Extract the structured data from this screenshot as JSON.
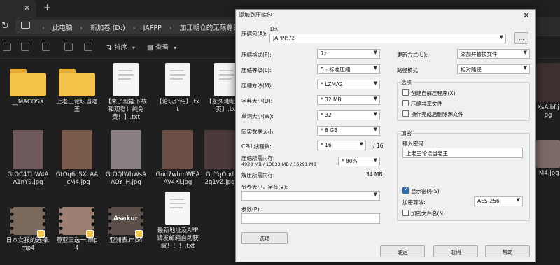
{
  "explorer": {
    "breadcrumb": [
      "此电脑",
      "新加卷 (D:)",
      "JAPPP",
      "加江朝仓的无限尊日"
    ],
    "toolbar": {
      "sort_label": "排序",
      "view_label": "查看"
    },
    "files": [
      {
        "name": "__MACOSX",
        "type": "folder"
      },
      {
        "name": "上老王论坛当老王",
        "type": "folder"
      },
      {
        "name": "【来了就能下载和观看！纯免费！】.txt",
        "type": "doc"
      },
      {
        "name": "【论坛介绍】.txt",
        "type": "doc"
      },
      {
        "name": "【永久地址发布页】.txt",
        "type": "doc"
      },
      {
        "name": "GtOC4TUW4AA1nY9.jpg",
        "type": "photo",
        "color": "#6e5a5a"
      },
      {
        "name": "GtOq6oSXcAA_cM4.jpg",
        "type": "photo",
        "color": "#7a5c4c"
      },
      {
        "name": "GtOQlWhWsAAOY_H.jpg",
        "type": "photo",
        "color": "#8a7f80"
      },
      {
        "name": "Gud7wbmWEAAV4Xi.jpg",
        "type": "photo",
        "color": "#6b4f45"
      },
      {
        "name": "GuYqOud2q1vZ.jpg",
        "type": "photo",
        "color": "#4a3a3a"
      },
      {
        "name": "日本女孩的选择.mp4",
        "type": "video",
        "color": "#7a6a5e"
      },
      {
        "name": "尊亚三选一.mp4",
        "type": "video",
        "color": "#9b8072"
      },
      {
        "name": "亚洲表.mp4",
        "type": "video",
        "color": "#5a4f49",
        "overlay": "Asakur"
      },
      {
        "name": "最新地址及APP请发邮箱自动获取！！！.txt",
        "type": "doc"
      }
    ],
    "right_partial": [
      {
        "name": "XsAlbf.jpg"
      },
      {
        "name": "lM4.jpg"
      }
    ]
  },
  "dialog": {
    "title": "添加到压缩包",
    "archive_label": "压缩包(A):",
    "archive_path": "D:\\",
    "archive_name": "JAPPP.7z",
    "browse_label": "...",
    "format_label": "压缩格式(F):",
    "format_value": "7z",
    "level_label": "压缩等级(L):",
    "level_value": "5 - 标准压缩",
    "method_label": "压缩方法(M):",
    "method_value": "* LZMA2",
    "dict_label": "字典大小(D):",
    "dict_value": "* 32 MB",
    "word_label": "单词大小(W):",
    "word_value": "* 32",
    "solid_label": "固实数据大小:",
    "solid_value": "* 8 GB",
    "threads_label": "CPU 线程数:",
    "threads_value": "* 16",
    "threads_total": "/ 16",
    "mem_compress_label": "压缩所需内存:",
    "mem_compress_detail": "4928 MB / 13033 MB / 16291 MB",
    "mem_percent_value": "* 80%",
    "mem_decompress_label": "解压所需内存:",
    "mem_decompress_value": "34 MB",
    "split_label": "分卷大小，字节(V):",
    "params_label": "参数(P):",
    "options_button": "选项",
    "update_label": "更新方式(U):",
    "update_value": "添加并替换文件",
    "path_label": "路径模式",
    "path_value": "相对路径",
    "options_group": "选项",
    "opt_sfx": "创建自解压程序(X)",
    "opt_shared": "压缩共享文件",
    "opt_delete": "操作完成后删除源文件",
    "encrypt_group": "加密",
    "password_label": "输入密码:",
    "password_value": "上老王论坛当老王",
    "show_password": "显示密码(S)",
    "encrypt_method_label": "加密算法:",
    "encrypt_method_value": "AES-256",
    "encrypt_names": "加密文件名(N)",
    "ok_button": "确定",
    "cancel_button": "取消",
    "help_button": "帮助"
  }
}
